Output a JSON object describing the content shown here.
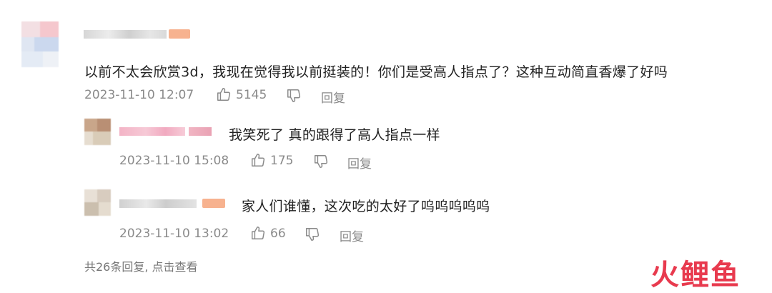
{
  "comment": {
    "text": "以前不太会欣赏3d，我现在觉得我以前挺装的！你们是受高人指点了？这种互动简直香爆了好吗",
    "timestamp": "2023-11-10 12:07",
    "likes": "5145",
    "reply_label": "回复"
  },
  "replies": [
    {
      "text": "我笑死了 真的跟得了高人指点一样",
      "timestamp": "2023-11-10 15:08",
      "likes": "175",
      "reply_label": "回复"
    },
    {
      "text": "家人们谁懂，这次吃的太好了呜呜呜呜呜",
      "timestamp": "2023-11-10 13:02",
      "likes": "66",
      "reply_label": "回复"
    }
  ],
  "footer": {
    "more_replies": "共26条回复, 点击查看"
  },
  "watermark": {
    "text": "火鲤鱼",
    "color": "#e83a4e"
  },
  "colors": {
    "meta": "#8a8a8a",
    "text": "#222222",
    "badge": "#f7b28f"
  }
}
